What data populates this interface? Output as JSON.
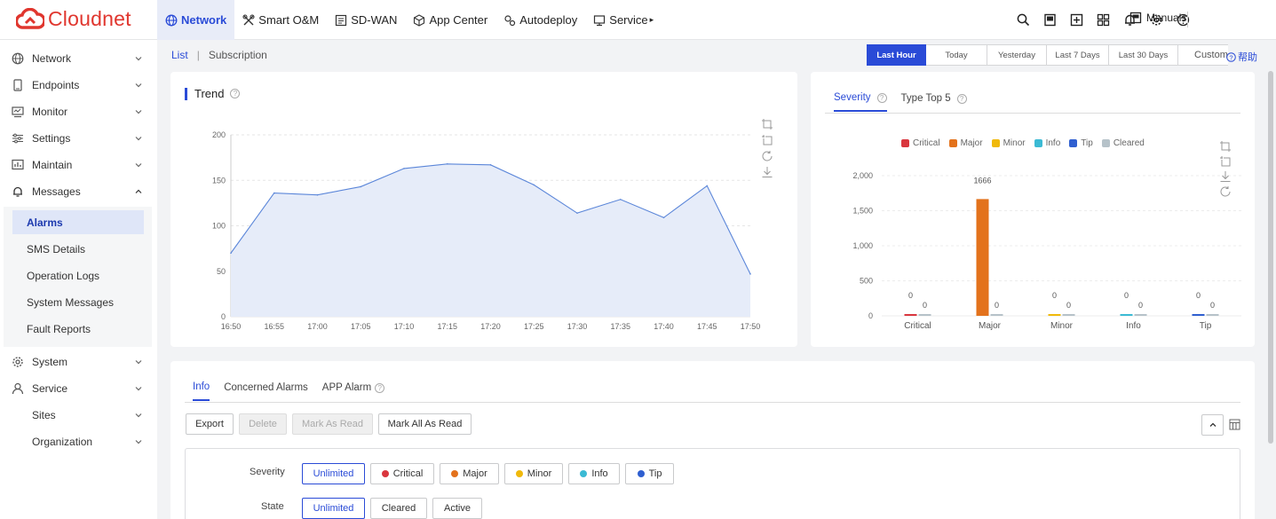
{
  "app": {
    "logo_text": "Cloudnet",
    "brand_color": "#e0362e",
    "accent_color": "#2a4bd7"
  },
  "topnav": {
    "items": [
      {
        "label": "Network",
        "icon": "globe-icon",
        "active": true
      },
      {
        "label": "Smart O&M",
        "icon": "tools-icon"
      },
      {
        "label": "SD-WAN",
        "icon": "sdwan-icon"
      },
      {
        "label": "App Center",
        "icon": "cube-icon"
      },
      {
        "label": "Autodeploy",
        "icon": "gears-icon"
      },
      {
        "label": "Service",
        "icon": "service-icon",
        "caret": "▸"
      }
    ],
    "right_icons": [
      "search-icon",
      "book-icon",
      "plus-box-icon",
      "grid-icon",
      "bell-icon",
      "gear-icon",
      "question-icon"
    ],
    "manuals_label": "Manuals"
  },
  "sidebar": {
    "items": [
      {
        "label": "Network",
        "icon": "globe-icon"
      },
      {
        "label": "Endpoints",
        "icon": "device-icon"
      },
      {
        "label": "Monitor",
        "icon": "monitor-icon"
      },
      {
        "label": "Settings",
        "icon": "sliders-icon"
      },
      {
        "label": "Maintain",
        "icon": "chart-box-icon"
      },
      {
        "label": "Messages",
        "icon": "bell-icon",
        "expanded": true
      }
    ],
    "subitems": [
      {
        "label": "Alarms",
        "active": true
      },
      {
        "label": "SMS Details"
      },
      {
        "label": "Operation Logs"
      },
      {
        "label": "System Messages"
      },
      {
        "label": "Fault Reports"
      }
    ],
    "bottom_items": [
      {
        "label": "System",
        "icon": "gear-icon"
      },
      {
        "label": "Service",
        "icon": "user-icon"
      },
      {
        "label": "Sites",
        "icon": ""
      },
      {
        "label": "Organization",
        "icon": ""
      }
    ]
  },
  "subnav": {
    "list": "List",
    "separator": "|",
    "subscription": "Subscription"
  },
  "time_range": {
    "options": [
      "Last Hour",
      "Today",
      "Yesterday",
      "Last 7 Days",
      "Last 30 Days",
      "Custom"
    ],
    "selected": "Last Hour",
    "help_label": "帮助"
  },
  "trend_panel": {
    "title": "Trend"
  },
  "severity_panel": {
    "tabs": [
      "Severity",
      "Type Top 5"
    ],
    "active_tab": "Severity"
  },
  "chart_data": [
    {
      "type": "area",
      "title": "Trend",
      "x": [
        "16:50",
        "16:55",
        "17:00",
        "17:05",
        "17:10",
        "17:15",
        "17:20",
        "17:25",
        "17:30",
        "17:35",
        "17:40",
        "17:45",
        "17:50"
      ],
      "values": [
        70,
        136,
        134,
        143,
        163,
        168,
        167,
        145,
        114,
        129,
        109,
        144,
        47
      ],
      "ylim": [
        0,
        200
      ],
      "yticks": [
        0,
        50,
        100,
        150,
        200
      ],
      "line_color": "#5b86d9",
      "fill_color": "#e6ecf9",
      "grid": true
    },
    {
      "type": "bar",
      "categories": [
        "Critical",
        "Major",
        "Minor",
        "Info",
        "Tip"
      ],
      "series": [
        {
          "name": "Critical",
          "color": "#d9363e",
          "values": [
            0,
            0,
            0,
            0,
            0
          ]
        },
        {
          "name": "Major",
          "color": "#e3721c",
          "values": [
            0,
            1666,
            0,
            0,
            0
          ]
        },
        {
          "name": "Minor",
          "color": "#f0b90b",
          "values": [
            0,
            0,
            0,
            0,
            0
          ]
        },
        {
          "name": "Info",
          "color": "#3bbad4",
          "values": [
            0,
            0,
            0,
            0,
            0
          ]
        },
        {
          "name": "Tip",
          "color": "#2f5fd0",
          "values": [
            0,
            0,
            0,
            0,
            0
          ]
        },
        {
          "name": "Cleared",
          "color": "#b6c2c9",
          "values": [
            0,
            0,
            0,
            0,
            0
          ]
        }
      ],
      "bars_shown_per_category": [
        [
          "Critical",
          "Cleared"
        ],
        [
          "Major",
          "Cleared"
        ],
        [
          "Minor",
          "Cleared"
        ],
        [
          "Info",
          "Cleared"
        ],
        [
          "Tip",
          "Cleared"
        ]
      ],
      "data_labels": [
        [
          "0",
          "0"
        ],
        [
          "1666",
          "0"
        ],
        [
          "0",
          "0"
        ],
        [
          "0",
          "0"
        ],
        [
          "0",
          "0"
        ]
      ],
      "ylim": [
        0,
        2000
      ],
      "yticks": [
        "0",
        "500",
        "1,000",
        "1,500",
        "2,000"
      ],
      "legend_position": "top",
      "grid": true
    }
  ],
  "alarm_section": {
    "tabs": [
      "Info",
      "Concerned Alarms",
      "APP Alarm"
    ],
    "active_tab": "Info",
    "buttons": [
      {
        "label": "Export",
        "disabled": false
      },
      {
        "label": "Delete",
        "disabled": true
      },
      {
        "label": "Mark As Read",
        "disabled": true
      },
      {
        "label": "Mark All As Read",
        "disabled": false
      }
    ],
    "filters": {
      "severity_label": "Severity",
      "severity_options": [
        {
          "label": "Unlimited",
          "selected": true
        },
        {
          "label": "Critical",
          "dot": "#d9363e"
        },
        {
          "label": "Major",
          "dot": "#e3721c"
        },
        {
          "label": "Minor",
          "dot": "#f0b90b"
        },
        {
          "label": "Info",
          "dot": "#3bbad4"
        },
        {
          "label": "Tip",
          "dot": "#2f5fd0"
        }
      ],
      "state_label": "State",
      "state_options": [
        {
          "label": "Unlimited",
          "selected": true
        },
        {
          "label": "Cleared"
        },
        {
          "label": "Active"
        }
      ]
    }
  }
}
